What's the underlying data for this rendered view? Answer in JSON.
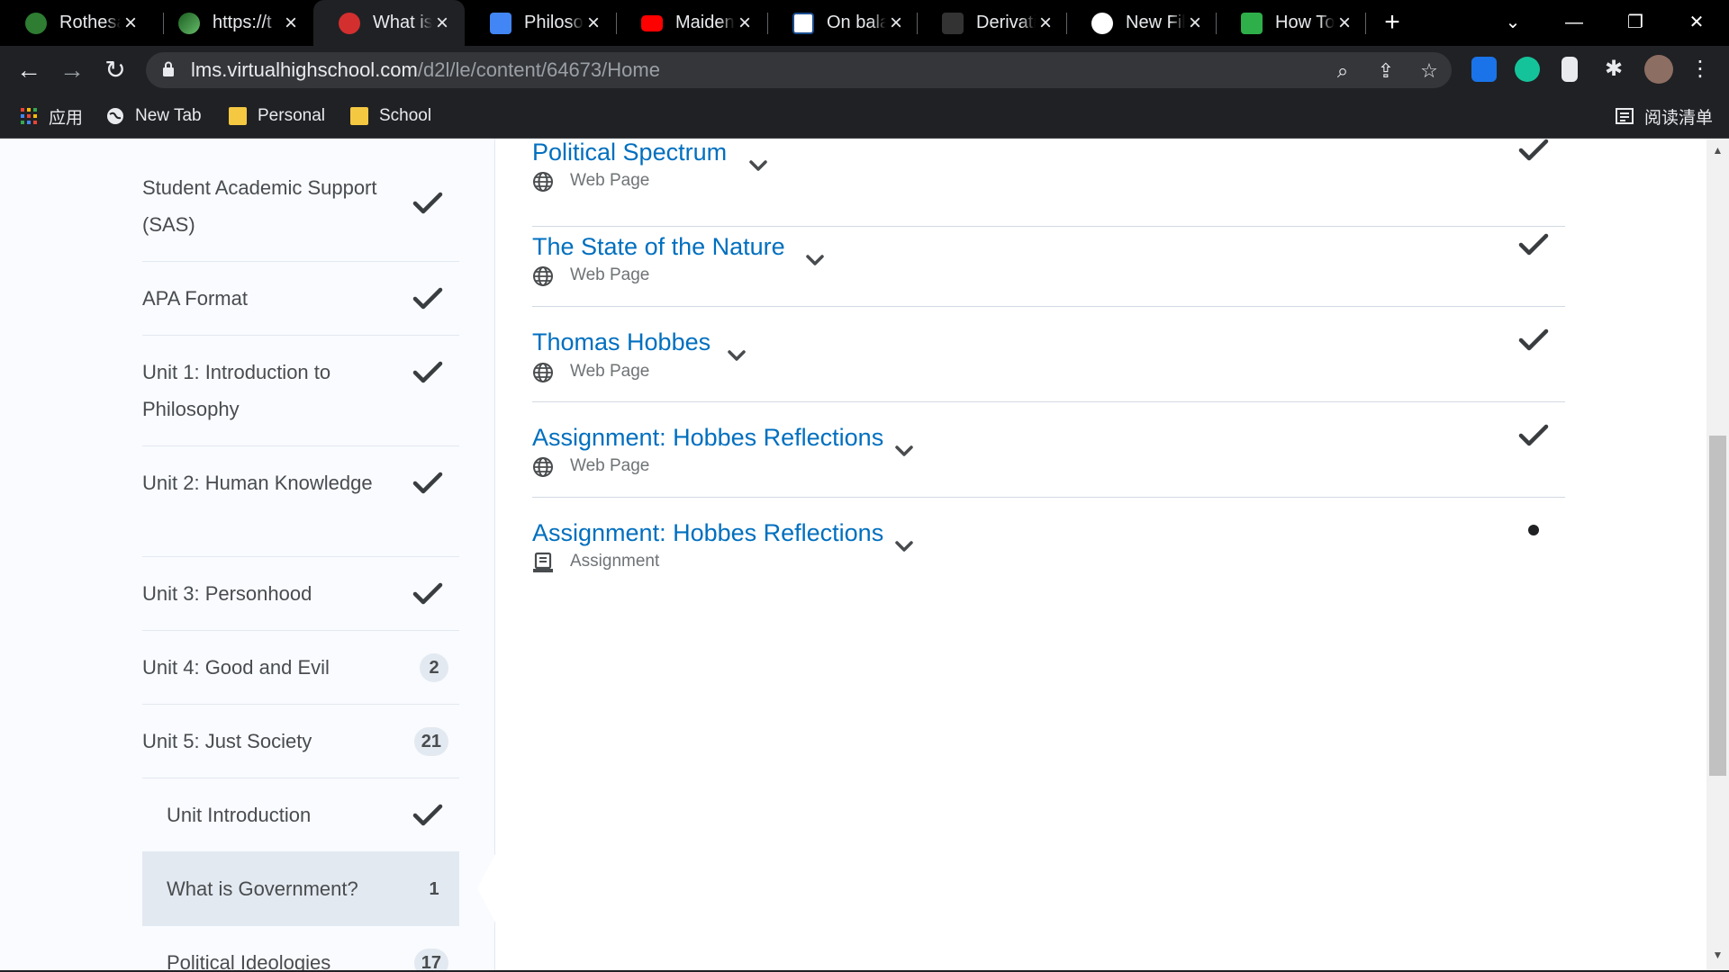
{
  "browser": {
    "tabs": [
      {
        "title": "Rothesa",
        "icon_color": "#2e7d32",
        "icon": "tree-icon"
      },
      {
        "title": "https://t",
        "icon_color": "#4caf50",
        "icon": "leaf-icon"
      },
      {
        "title": "What is",
        "icon_color": "#d32f2f",
        "icon": "apple-icon",
        "active": true
      },
      {
        "title": "Philosop",
        "icon_color": "#4285f4",
        "icon": "docs-icon"
      },
      {
        "title": "Maiden",
        "icon_color": "#ff0000",
        "icon": "youtube-icon"
      },
      {
        "title": "On bala",
        "icon_color": "#1a4d8f",
        "icon": "eu-icon"
      },
      {
        "title": "Derivati",
        "icon_color": "#333333",
        "icon": "derivative-icon"
      },
      {
        "title": "New File",
        "icon_color": "#ffffff",
        "icon": "github-icon"
      },
      {
        "title": "How To",
        "icon_color": "#2eaf4a",
        "icon": "wikihow-icon"
      }
    ],
    "new_tab": "+",
    "window_controls": {
      "menu": "⌄",
      "minimize": "—",
      "restore": "❐",
      "close": "✕"
    },
    "url_host": "lms.virtualhighschool.com",
    "url_path": "/d2l/le/content/64673/Home",
    "bookmarks": [
      {
        "label": "应用",
        "icon": "apps-grid-icon"
      },
      {
        "label": "New Tab",
        "icon": "globe-icon"
      },
      {
        "label": "Personal",
        "icon": "folder-icon"
      },
      {
        "label": "School",
        "icon": "folder-icon"
      }
    ],
    "reading_list": "阅读清单"
  },
  "sidebar": {
    "items": [
      {
        "label": "Student Academic Support (SAS)",
        "status": "check"
      },
      {
        "label": "APA Format",
        "status": "check"
      },
      {
        "label": "Unit 1: Introduction to Philosophy",
        "status": "check"
      },
      {
        "label": "Unit 2: Human Knowledge",
        "status": "check"
      },
      {
        "label": "Unit 3: Personhood",
        "status": "check"
      },
      {
        "label": "Unit 4: Good and Evil",
        "status": "badge",
        "count": "2"
      },
      {
        "label": "Unit 5: Just Society",
        "status": "badge",
        "count": "21"
      },
      {
        "label": "Unit Introduction",
        "status": "check",
        "sub": true
      },
      {
        "label": "What is Government?",
        "status": "badge",
        "count": "1",
        "sub": true,
        "selected": true
      },
      {
        "label": "Political Ideologies",
        "status": "badge",
        "count": "17",
        "sub": true
      }
    ]
  },
  "content": {
    "topics": [
      {
        "title": "Political Spectrum",
        "type": "Web Page",
        "status": "check"
      },
      {
        "title": "The State of the Nature",
        "type": "Web Page",
        "status": "check"
      },
      {
        "title": "Thomas Hobbes",
        "type": "Web Page",
        "status": "check"
      },
      {
        "title": "Assignment: Hobbes Reflections",
        "type": "Web Page",
        "status": "check"
      },
      {
        "title": "Assignment: Hobbes Reflections",
        "type": "Assignment",
        "status": "dot"
      }
    ]
  },
  "colors": {
    "link": "#006fbf",
    "sidebar_bg": "#f9fbff",
    "chrome_bg": "#202124"
  }
}
